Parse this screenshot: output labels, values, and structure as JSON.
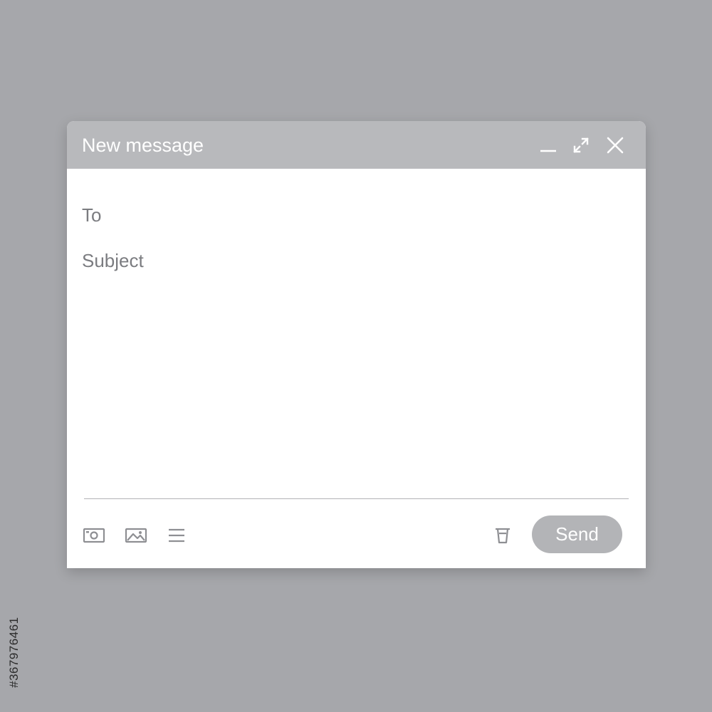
{
  "compose": {
    "title": "New message",
    "to_label": "To",
    "subject_label": "Subject",
    "send_label": "Send"
  },
  "icons": {
    "minimize": "minimize-icon",
    "expand": "expand-icon",
    "close": "close-icon",
    "camera": "camera-icon",
    "image": "image-icon",
    "format": "format-list-icon",
    "trash": "trash-icon"
  },
  "colors": {
    "background": "#a6a7ab",
    "titlebar": "#b8b9bc",
    "send_button": "#b3b4b7",
    "label_text": "#7b7c80",
    "icon": "#8e8f93"
  },
  "watermark": {
    "stock_id": "#367976461"
  }
}
